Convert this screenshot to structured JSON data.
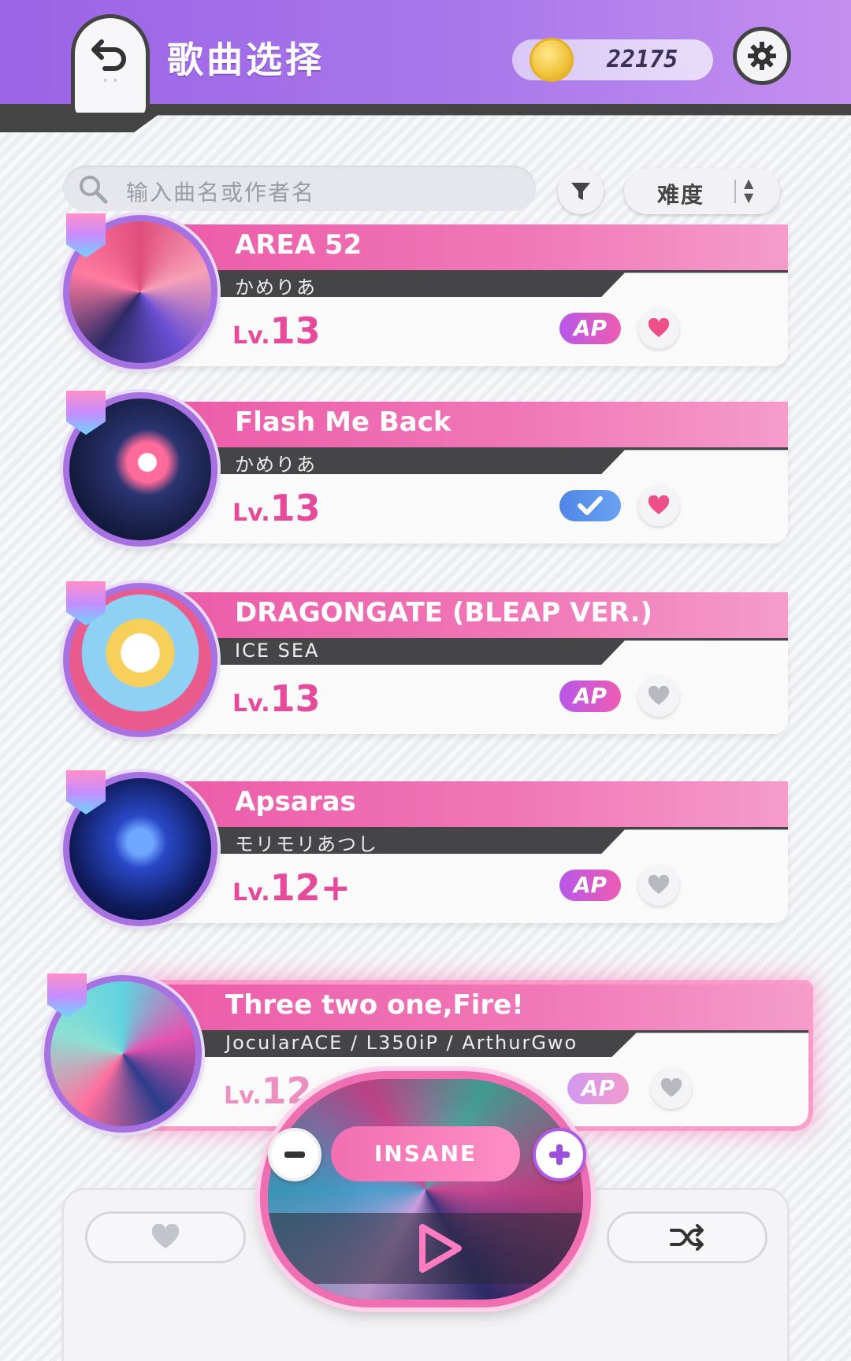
{
  "header": {
    "title": "歌曲选择",
    "coins": "22175"
  },
  "search": {
    "placeholder": "输入曲名或作者名"
  },
  "sort": {
    "label": "难度"
  },
  "songs": [
    {
      "title": "AREA 52",
      "artist": "かめりあ",
      "level_prefix": "Lv.",
      "level": "13",
      "badge": "AP",
      "favorited": true
    },
    {
      "title": "Flash Me Back",
      "artist": "かめりあ",
      "level_prefix": "Lv.",
      "level": "13",
      "badge": "check",
      "favorited": true
    },
    {
      "title": "DRAGONGATE (BLEAP VER.)",
      "artist": "ICE SEA",
      "level_prefix": "Lv.",
      "level": "13",
      "badge": "AP",
      "favorited": false
    },
    {
      "title": "Apsaras",
      "artist": "モリモリあつし",
      "level_prefix": "Lv.",
      "level": "12+",
      "badge": "AP",
      "favorited": false
    },
    {
      "title": "Three two one,Fire!",
      "artist": "JocularACE / L350iP / ArthurGwo",
      "level_prefix": "Lv.",
      "level": "12",
      "badge": "AP",
      "favorited": false,
      "selected": true
    }
  ],
  "player": {
    "difficulty": "INSANE"
  },
  "colors": {
    "accent_pink": "#ec5aa8",
    "header_purple": "#9b63e6",
    "level_pink": "#e64a9b"
  },
  "icons": [
    "back-arrow-icon",
    "coin-icon",
    "gear-icon",
    "search-icon",
    "filter-icon",
    "sort-arrows-icon",
    "heart-icon",
    "check-icon",
    "play-icon",
    "minus-icon",
    "plus-icon",
    "shuffle-icon"
  ]
}
